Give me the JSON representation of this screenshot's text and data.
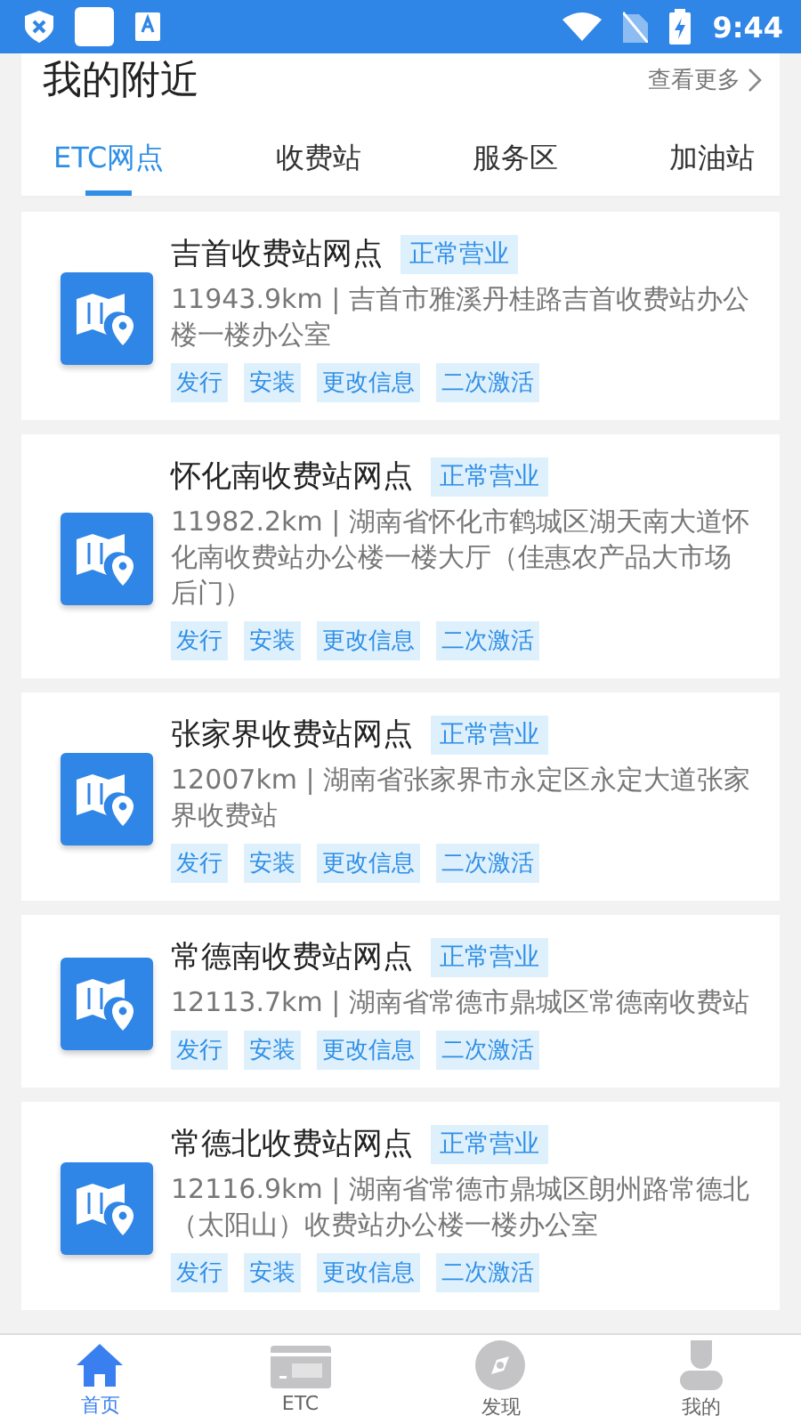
{
  "status_bar": {
    "time": "9:44"
  },
  "nearby": {
    "title": "我的附近",
    "more": "查看更多"
  },
  "tabs": [
    {
      "label": "ETC网点",
      "selected": true
    },
    {
      "label": "收费站",
      "selected": false
    },
    {
      "label": "服务区",
      "selected": false
    },
    {
      "label": "加油站",
      "selected": false
    }
  ],
  "outlets": [
    {
      "name": "吉首收费站网点",
      "status": "正常营业",
      "address": "11943.9km | 吉首市雅溪丹桂路吉首收费站办公楼一楼办公室",
      "services": [
        "发行",
        "安装",
        "更改信息",
        "二次激活"
      ]
    },
    {
      "name": "怀化南收费站网点",
      "status": "正常营业",
      "address": "11982.2km | 湖南省怀化市鹤城区湖天南大道怀化南收费站办公楼一楼大厅（佳惠农产品大市场后门）",
      "services": [
        "发行",
        "安装",
        "更改信息",
        "二次激活"
      ]
    },
    {
      "name": "张家界收费站网点",
      "status": "正常营业",
      "address": "12007km | 湖南省张家界市永定区永定大道张家界收费站",
      "services": [
        "发行",
        "安装",
        "更改信息",
        "二次激活"
      ]
    },
    {
      "name": "常德南收费站网点",
      "status": "正常营业",
      "address": "12113.7km | 湖南省常德市鼎城区常德南收费站",
      "services": [
        "发行",
        "安装",
        "更改信息",
        "二次激活"
      ]
    },
    {
      "name": "常德北收费站网点",
      "status": "正常营业",
      "address": "12116.9km | 湖南省常德市鼎城区朗州路常德北（太阳山）收费站办公楼一楼办公室",
      "services": [
        "发行",
        "安装",
        "更改信息",
        "二次激活"
      ]
    }
  ],
  "bottom_nav": [
    {
      "kind": "home",
      "label": "首页",
      "selected": true
    },
    {
      "kind": "etc",
      "label": "ETC",
      "selected": false
    },
    {
      "kind": "discover",
      "label": "发现",
      "selected": false
    },
    {
      "kind": "me",
      "label": "我的",
      "selected": false
    }
  ]
}
